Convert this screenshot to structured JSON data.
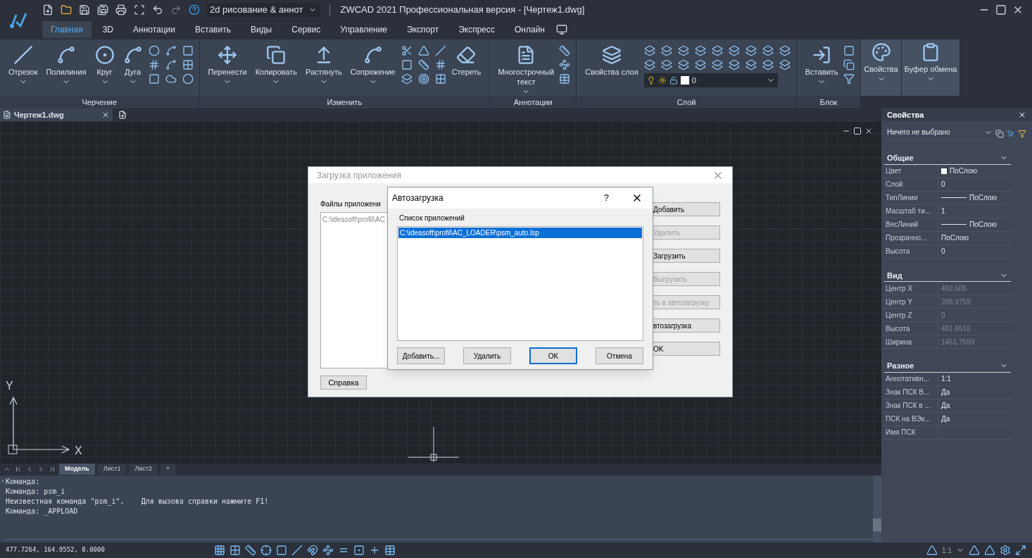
{
  "app": {
    "workspace": "2d рисование & аннот",
    "title": "ZWCAD 2021 Профессиональная версия - [Чертеж1.dwg]"
  },
  "ribbon_tabs": [
    {
      "label": "Главная",
      "selected": true
    },
    {
      "label": "3D",
      "selected": false
    },
    {
      "label": "Аннотации",
      "selected": false
    },
    {
      "label": "Вставить",
      "selected": false
    },
    {
      "label": "Виды",
      "selected": false
    },
    {
      "label": "Сервис",
      "selected": false
    },
    {
      "label": "Управление",
      "selected": false
    },
    {
      "label": "Экспорт",
      "selected": false
    },
    {
      "label": "Экспресс",
      "selected": false
    },
    {
      "label": "Онлайн",
      "selected": false
    }
  ],
  "ribbon_panels": [
    {
      "title": "Черчение",
      "tools": [
        {
          "label": "Отрезок",
          "dropdown": true
        },
        {
          "label": "Полилиния",
          "dropdown": true
        },
        {
          "label": "Круг",
          "dropdown": true
        },
        {
          "label": "Дуга",
          "dropdown": true
        }
      ]
    },
    {
      "title": "Изменить",
      "tools": [
        {
          "label": "Перенести",
          "dropdown": true
        },
        {
          "label": "Копировать",
          "dropdown": true
        },
        {
          "label": "Растянуть",
          "dropdown": true
        },
        {
          "label": "Сопряжение",
          "dropdown": true
        },
        {
          "label": "Стереть",
          "dropdown": false
        }
      ]
    },
    {
      "title": "Аннотации",
      "tools": [
        {
          "label": "Многострочный текст",
          "dropdown": true
        }
      ]
    },
    {
      "title": "Слой",
      "tools": [
        {
          "label": "Свойства слоя",
          "dropdown": false
        }
      ],
      "layer_value": "0"
    },
    {
      "title": "Блок",
      "tools": [
        {
          "label": "Вставить",
          "dropdown": true
        }
      ]
    }
  ],
  "ribbon_extra": [
    {
      "label": "Свойства",
      "dropdown": true
    },
    {
      "label": "Буфер обмена",
      "dropdown": true
    }
  ],
  "document_tab": "Чертеж1.dwg",
  "axes": {
    "y": "Y",
    "x": "X"
  },
  "app_load_dialog": {
    "title": "Загрузка приложения",
    "files_label": "Файлы приложени",
    "files": [
      "C:\\ideasoft\\profil\\AC"
    ],
    "buttons": [
      {
        "label": "Добавить",
        "disabled": false
      },
      {
        "label": "Удалить",
        "disabled": true
      },
      {
        "label": "Загрузить",
        "disabled": false
      },
      {
        "label": "Выгрузить",
        "disabled": true
      },
      {
        "label": "ть в автозагрузку",
        "disabled": true
      },
      {
        "label": "втозагрузка",
        "disabled": false
      },
      {
        "label": "OK",
        "disabled": false
      }
    ],
    "help": "Справка"
  },
  "autoload_dialog": {
    "title": "Автозагрузка",
    "help": "?",
    "list_label": "Список приложений",
    "items": [
      {
        "label": "C:\\ideasoft\\profil\\AC_LOADER\\psm_auto.lsp",
        "selected": true
      }
    ],
    "buttons": [
      {
        "label": "Добавить...",
        "default": false
      },
      {
        "label": "Удалить",
        "default": false
      },
      {
        "label": "OK",
        "default": true
      },
      {
        "label": "Отмена",
        "default": false
      }
    ]
  },
  "layout_tabs": [
    {
      "label": "Модель",
      "selected": true
    },
    {
      "label": "Лист1",
      "selected": false
    },
    {
      "label": "Лист2",
      "selected": false
    }
  ],
  "add_layout": "+",
  "command_lines": [
    "Команда:",
    "Команда: psm_i",
    "Неизвестная команда \"psm_i\".    Для вызова справки нажмите F1!",
    "Команда: _APPLOAD"
  ],
  "status_bar": {
    "coordinates": "477.7264, 164.9552, 0.0000",
    "scale": "1:1"
  },
  "properties": {
    "title": "Свойства",
    "selection": "Ничего не выбрано",
    "sections": [
      {
        "title": "Общие",
        "expanded": true,
        "readonly": false,
        "rows": [
          {
            "label": "Цвет",
            "value": "ПоСлою",
            "kind": "swatch"
          },
          {
            "label": "Слой",
            "value": "0",
            "kind": "text"
          },
          {
            "label": "ТипЛинии",
            "value": "ПоСлою",
            "kind": "line"
          },
          {
            "label": "Масштаб ти...",
            "value": "1",
            "kind": "text"
          },
          {
            "label": "ВесЛиний",
            "value": "ПоСлою",
            "kind": "line"
          },
          {
            "label": "Прозрачно...",
            "value": "ПоСлою",
            "kind": "text"
          },
          {
            "label": "Высота",
            "value": "0",
            "kind": "text"
          }
        ]
      },
      {
        "title": "Вид",
        "expanded": true,
        "readonly": true,
        "rows": [
          {
            "label": "Центр X",
            "value": "493.605",
            "kind": "text"
          },
          {
            "label": "Центр Y",
            "value": "398.9759",
            "kind": "text"
          },
          {
            "label": "Центр Z",
            "value": "0",
            "kind": "text"
          },
          {
            "label": "Высота",
            "value": "481.6516",
            "kind": "text"
          },
          {
            "label": "Ширина",
            "value": "1451.7599",
            "kind": "text"
          }
        ]
      },
      {
        "title": "Разное",
        "expanded": true,
        "readonly": false,
        "rows": [
          {
            "label": "Аннотативн...",
            "value": "1:1",
            "kind": "text"
          },
          {
            "label": "Знак ПСК В...",
            "value": "Да",
            "kind": "text"
          },
          {
            "label": "Знак ПСК в ...",
            "value": "Да",
            "kind": "text"
          },
          {
            "label": "ПСК на ВЭк...",
            "value": "Да",
            "kind": "text"
          },
          {
            "label": "Имя ПСК",
            "kind": "text"
          }
        ]
      }
    ]
  }
}
